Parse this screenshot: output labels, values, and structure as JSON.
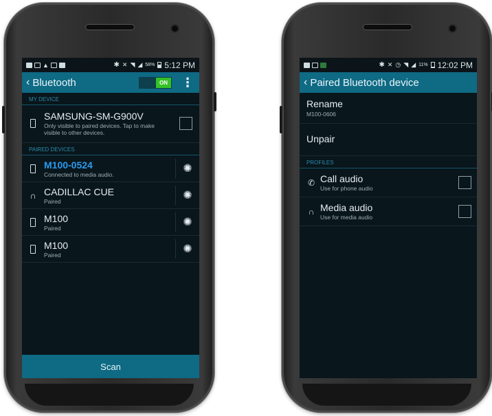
{
  "left_phone": {
    "statusbar": {
      "battery": "58%",
      "time": "5:12 PM"
    },
    "actionbar": {
      "title": "Bluetooth",
      "toggle_label": "ON",
      "back_icon": "chevron-left-icon",
      "menu_icon": "overflow-menu-icon"
    },
    "my_device": {
      "header": "MY DEVICE",
      "name": "SAMSUNG-SM-G900V",
      "subtitle": "Only visible to paired devices. Tap to make visible to other devices."
    },
    "paired": {
      "header": "PAIRED DEVICES",
      "items": [
        {
          "name": "M100-0524",
          "status": "Connected to media audio.",
          "icon": "phone-icon",
          "active": true
        },
        {
          "name": "CADILLAC CUE",
          "status": "Paired",
          "icon": "headphones-icon",
          "active": false
        },
        {
          "name": "M100",
          "status": "Paired",
          "icon": "phone-icon",
          "active": false
        },
        {
          "name": "M100",
          "status": "Paired",
          "icon": "phone-icon",
          "active": false
        }
      ]
    },
    "scan_label": "Scan"
  },
  "right_phone": {
    "statusbar": {
      "battery": "11%",
      "time": "12:02 PM"
    },
    "actionbar": {
      "title": "Paired Bluetooth device",
      "back_icon": "chevron-left-icon"
    },
    "rename": {
      "label": "Rename",
      "value": "M100-0606"
    },
    "unpair_label": "Unpair",
    "profiles": {
      "header": "PROFILES",
      "items": [
        {
          "title": "Call audio",
          "subtitle": "Use for phone audio",
          "icon": "phone-call-icon"
        },
        {
          "title": "Media audio",
          "subtitle": "Use for media audio",
          "icon": "headphones-icon"
        }
      ]
    }
  },
  "colors": {
    "accent": "#0f6a84",
    "active_device": "#2a9bf0",
    "toggle_on": "#35c227",
    "section_header": "#2b8aa8",
    "screen_bg": "#09161c"
  }
}
